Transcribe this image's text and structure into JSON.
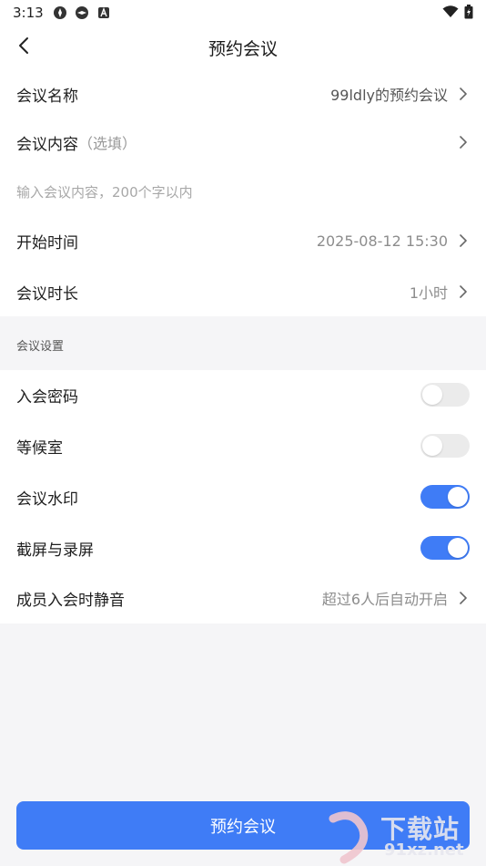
{
  "status": {
    "time": "3:13"
  },
  "nav": {
    "title": "预约会议"
  },
  "form": {
    "meeting_name": {
      "label": "会议名称",
      "value": "99ldly的预约会议"
    },
    "meeting_content": {
      "label": "会议内容",
      "hint": "（选填）",
      "placeholder": "输入会议内容，200个字以内"
    },
    "start_time": {
      "label": "开始时间",
      "value": "2025-08-12 15:30"
    },
    "duration": {
      "label": "会议时长",
      "value": "1小时"
    }
  },
  "settings": {
    "header": "会议设置",
    "items": [
      {
        "label": "入会密码",
        "on": false
      },
      {
        "label": "等候室",
        "on": false
      },
      {
        "label": "会议水印",
        "on": true
      },
      {
        "label": "截屏与录屏",
        "on": true
      }
    ],
    "mute": {
      "label": "成员入会时静音",
      "value": "超过6人后自动开启"
    }
  },
  "bottom_button": {
    "label": "预约会议"
  },
  "watermark": {
    "big": "下载站",
    "small": "91xz.net"
  },
  "colors": {
    "accent": "#3f7cf6",
    "toggle_off": "#ebebeb"
  }
}
